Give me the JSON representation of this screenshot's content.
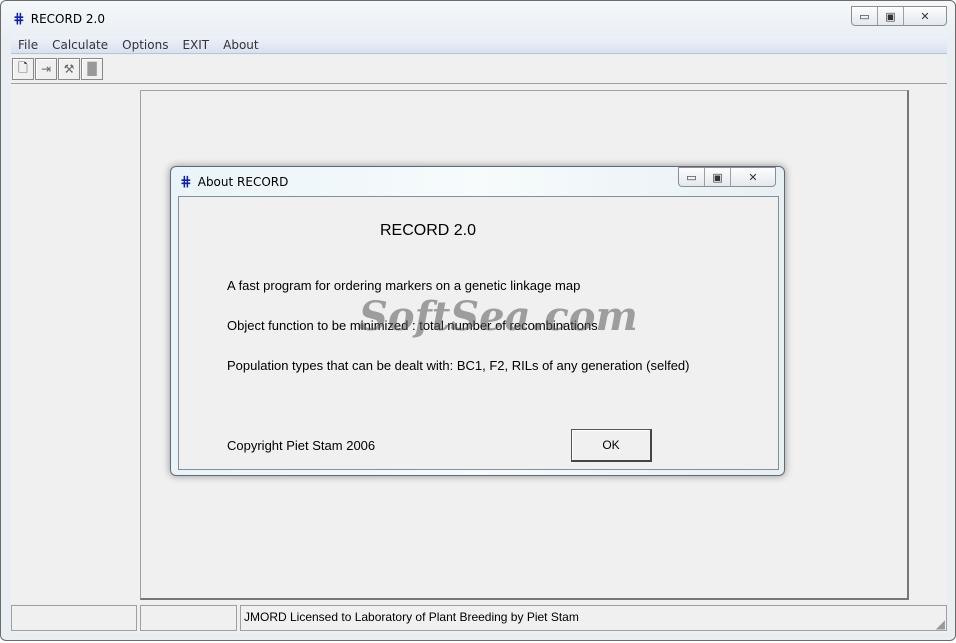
{
  "window": {
    "title": "RECORD 2.0",
    "icon": "grid-icon",
    "controls": {
      "minimize": "minimize-icon",
      "maximize": "maximize-icon",
      "close": "close-icon"
    }
  },
  "menu": [
    "File",
    "Calculate",
    "Options",
    "EXIT",
    "About"
  ],
  "toolbar": [
    {
      "name": "new-document-icon",
      "glyph": "🗋"
    },
    {
      "name": "import-icon",
      "glyph": "⇥"
    },
    {
      "name": "tools-icon",
      "glyph": "⚒"
    },
    {
      "name": "stop-icon",
      "glyph": "█"
    }
  ],
  "status": {
    "panel1": "",
    "panel2": "",
    "panel3": "JMORD Licensed to Laboratory of Plant Breeding by Piet Stam"
  },
  "dialog": {
    "title": "About RECORD",
    "heading": "RECORD 2.0",
    "line1": "A fast program for ordering markers on a genetic linkage map",
    "line2": "Object function to be minimized : total number of recombinations",
    "line3": "Population types that can be dealt with: BC1,  F2, RILs of any generation (selfed)",
    "copyright": "Copyright  Piet Stam 2006",
    "ok": "OK"
  },
  "watermark": "SoftSea.com"
}
